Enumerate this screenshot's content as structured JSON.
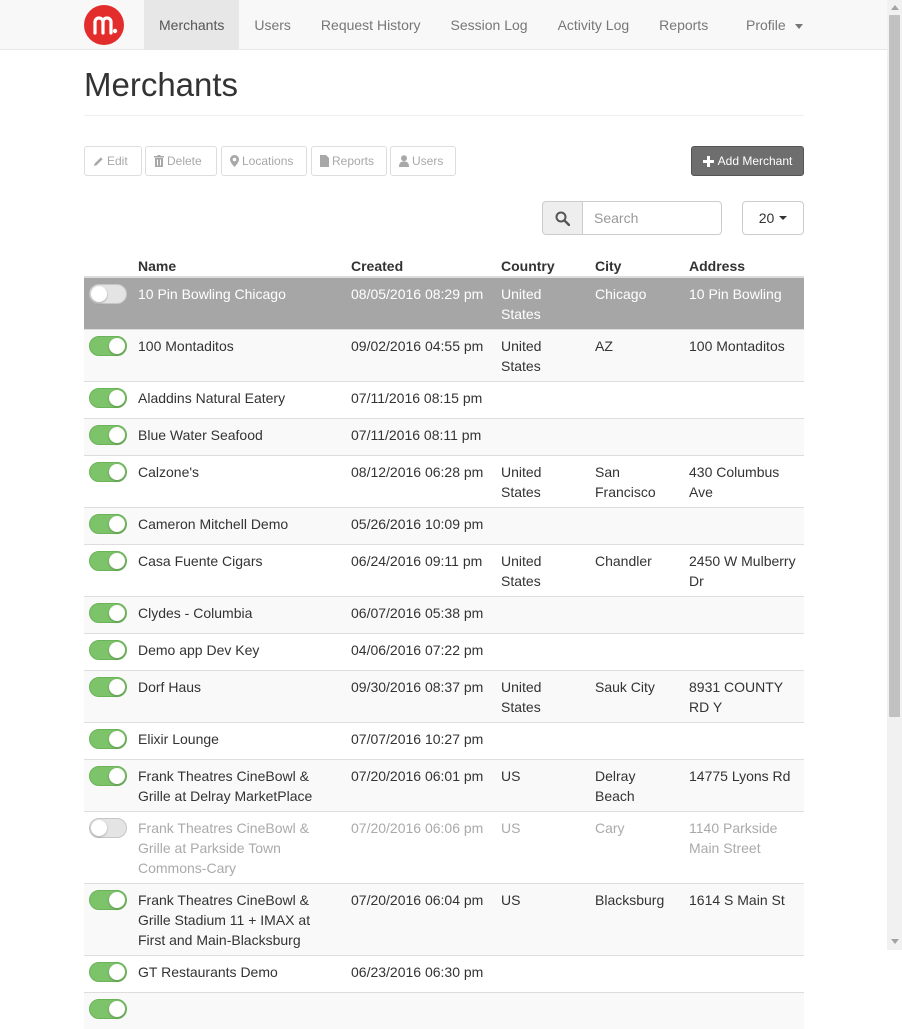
{
  "navbar": {
    "logo_letter": "m",
    "items": [
      {
        "label": "Merchants",
        "active": true
      },
      {
        "label": "Users"
      },
      {
        "label": "Request History"
      },
      {
        "label": "Session Log"
      },
      {
        "label": "Activity Log"
      },
      {
        "label": "Reports"
      }
    ],
    "profile_label": "Profile"
  },
  "page": {
    "title": "Merchants"
  },
  "toolbar": {
    "edit_label": "Edit",
    "delete_label": "Delete",
    "locations_label": "Locations",
    "reports_label": "Reports",
    "users_label": "Users",
    "add_label": "Add Merchant"
  },
  "search": {
    "placeholder": "Search",
    "value": ""
  },
  "page_size": {
    "value": "20"
  },
  "table": {
    "columns": [
      "",
      "Name",
      "Created",
      "Country",
      "City",
      "Address"
    ],
    "rows": [
      {
        "enabled": false,
        "selected": true,
        "name": "10 Pin Bowling Chicago",
        "created": "08/05/2016 08:29 pm",
        "country": "United States",
        "city": "Chicago",
        "address": "10 Pin Bowling"
      },
      {
        "enabled": true,
        "name": "100 Montaditos",
        "created": "09/02/2016 04:55 pm",
        "country": "United States",
        "city": "AZ",
        "address": "100 Montaditos"
      },
      {
        "enabled": true,
        "name": "Aladdins Natural Eatery",
        "created": "07/11/2016 08:15 pm",
        "country": "",
        "city": "",
        "address": ""
      },
      {
        "enabled": true,
        "name": "Blue Water Seafood",
        "created": "07/11/2016 08:11 pm",
        "country": "",
        "city": "",
        "address": ""
      },
      {
        "enabled": true,
        "name": "Calzone's",
        "created": "08/12/2016 06:28 pm",
        "country": "United States",
        "city": "San Francisco",
        "address": "430 Columbus Ave"
      },
      {
        "enabled": true,
        "name": "Cameron Mitchell Demo",
        "created": "05/26/2016 10:09 pm",
        "country": "",
        "city": "",
        "address": ""
      },
      {
        "enabled": true,
        "name": "Casa Fuente Cigars",
        "created": "06/24/2016 09:11 pm",
        "country": "United States",
        "city": "Chandler",
        "address": "2450 W Mulberry Dr"
      },
      {
        "enabled": true,
        "name": "Clydes - Columbia",
        "created": "06/07/2016 05:38 pm",
        "country": "",
        "city": "",
        "address": ""
      },
      {
        "enabled": true,
        "name": "Demo app Dev Key",
        "created": "04/06/2016 07:22 pm",
        "country": "",
        "city": "",
        "address": ""
      },
      {
        "enabled": true,
        "name": "Dorf Haus",
        "created": "09/30/2016 08:37 pm",
        "country": "United States",
        "city": "Sauk City",
        "address": "8931 COUNTY RD Y"
      },
      {
        "enabled": true,
        "name": "Elixir Lounge",
        "created": "07/07/2016 10:27 pm",
        "country": "",
        "city": "",
        "address": ""
      },
      {
        "enabled": true,
        "name": "Frank Theatres CineBowl & Grille at Delray MarketPlace",
        "created": "07/20/2016 06:01 pm",
        "country": "US",
        "city": "Delray Beach",
        "address": "14775 Lyons Rd"
      },
      {
        "enabled": false,
        "disabled": true,
        "name": "Frank Theatres CineBowl & Grille at Parkside Town Commons-Cary",
        "created": "07/20/2016 06:06 pm",
        "country": "US",
        "city": "Cary",
        "address": "1140 Parkside Main Street"
      },
      {
        "enabled": true,
        "name": "Frank Theatres CineBowl & Grille Stadium 11 + IMAX at First and Main-Blacksburg",
        "created": "07/20/2016 06:04 pm",
        "country": "US",
        "city": "Blacksburg",
        "address": "1614 S Main St"
      },
      {
        "enabled": true,
        "name": "GT Restaurants Demo",
        "created": "06/23/2016 06:30 pm",
        "country": "",
        "city": "",
        "address": ""
      },
      {
        "enabled": true,
        "name": "",
        "created": "",
        "country": "",
        "city": "",
        "address": ""
      }
    ]
  },
  "colors": {
    "brand": "#e32d2d",
    "toggle_on": "#7dc36a",
    "selected_row": "#a6a6a6",
    "add_button": "#6e6e6e"
  }
}
